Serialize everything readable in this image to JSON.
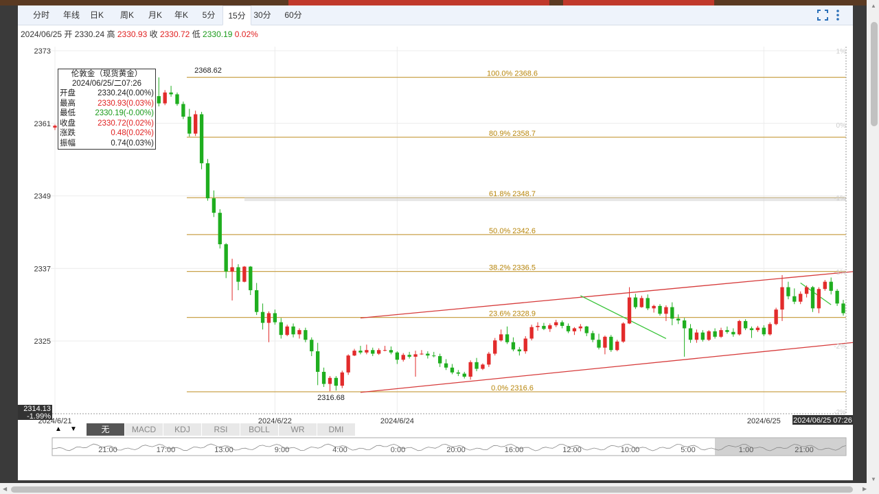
{
  "tabs": [
    {
      "label": "分时"
    },
    {
      "label": "年线"
    },
    {
      "label": "日K"
    },
    {
      "label": "周K"
    },
    {
      "label": "月K"
    },
    {
      "label": "年K"
    },
    {
      "label": "5分"
    },
    {
      "label": "15分",
      "active": true
    },
    {
      "label": "30分"
    },
    {
      "label": "60分"
    }
  ],
  "toolbar": {
    "fullscreen_icon": "fullscreen-icon",
    "menu_icon": "more-vertical-icon"
  },
  "ohlc": {
    "date": "2024/06/25",
    "open_label": "开",
    "open": "2330.24",
    "high_label": "高",
    "high": "2330.93",
    "close_label": "收",
    "close": "2330.72",
    "low_label": "低",
    "low": "2330.19",
    "change": "0.02%"
  },
  "tooltip": {
    "title": "伦敦金（现货黄金）",
    "datetime": "2024/06/25/二07:26",
    "rows": [
      {
        "label": "开盘",
        "value": "2330.24(0.00%)",
        "color": "normal"
      },
      {
        "label": "最高",
        "value": "2330.93(0.03%)",
        "color": "up"
      },
      {
        "label": "最低",
        "value": "2330.19(-0.00%)",
        "color": "dn"
      },
      {
        "label": "收盘",
        "value": "2330.72(0.02%)",
        "color": "up"
      },
      {
        "label": "涨跌",
        "value": "0.48(0.02%)",
        "color": "up"
      },
      {
        "label": "振幅",
        "value": "0.74(0.03%)",
        "color": "normal"
      }
    ]
  },
  "indicators": [
    {
      "label": "无",
      "active": true
    },
    {
      "label": "MACD"
    },
    {
      "label": "KDJ"
    },
    {
      "label": "RSI"
    },
    {
      "label": "BOLL"
    },
    {
      "label": "WR"
    },
    {
      "label": "DMI"
    }
  ],
  "nav_arrows": {
    "up": "▲",
    "down": "▼"
  },
  "chart_data": {
    "type": "candlestick",
    "y_ticks": [
      2373,
      2361,
      2349,
      2337,
      2325
    ],
    "ylim": [
      2313,
      2374
    ],
    "x_labels": [
      {
        "label": "2024/6/21",
        "at": 0
      },
      {
        "label": "2024/6/22",
        "at": 36
      },
      {
        "label": "2024/6/24",
        "at": 56
      },
      {
        "label": "2024/6/25",
        "at": 116
      }
    ],
    "crosshair_x_label": "2024/06/25 07:26",
    "crosshair_y_label": "2314.13",
    "crosshair_y_pct": "-1.99%",
    "right_pct_labels": [
      "1%",
      "0%",
      "-1%",
      "-1%",
      "-2%",
      "-2%"
    ],
    "fib_levels": [
      {
        "label": "100.0% 2368.6",
        "value": 2368.62
      },
      {
        "label": "80.9% 2358.7",
        "value": 2358.7
      },
      {
        "label": "61.8% 2348.7",
        "value": 2348.7
      },
      {
        "label": "50.0% 2342.6",
        "value": 2342.6
      },
      {
        "label": "38.2% 2336.5",
        "value": 2336.5
      },
      {
        "label": "23.6% 2328.9",
        "value": 2328.9
      },
      {
        "label": "0.0% 2316.6",
        "value": 2316.6
      }
    ],
    "high_label": "2368.62",
    "low_label": "2316.68",
    "channel_upper": [
      [
        50,
        2328.8
      ],
      [
        135,
        2336.9
      ]
    ],
    "channel_lower": [
      [
        50,
        2316.5
      ],
      [
        135,
        2325.2
      ]
    ],
    "green_trend_1": [
      [
        86,
        2332.5
      ],
      [
        100,
        2325.4
      ]
    ],
    "green_trend_2": [
      [
        122,
        2334.6
      ],
      [
        127,
        2331
      ]
    ],
    "candles": [
      [
        2360.3,
        2360.8,
        2359.9,
        2360.6
      ],
      [
        2360.6,
        2361.4,
        2360.2,
        2361.1
      ],
      [
        2361.1,
        2362,
        2360.7,
        2361.7
      ],
      [
        2361.7,
        2362.3,
        2361.3,
        2362.1
      ],
      [
        2362.1,
        2362.5,
        2361.6,
        2361.9
      ],
      [
        2361.9,
        2362.9,
        2361.5,
        2362.6
      ],
      [
        2362.6,
        2363.4,
        2362.1,
        2363.1
      ],
      [
        2363.1,
        2363.2,
        2358.5,
        2359.3
      ],
      [
        2359.3,
        2362.9,
        2358.9,
        2362.5
      ],
      [
        2362.5,
        2367.4,
        2362.2,
        2365.6
      ],
      [
        2365.6,
        2366.2,
        2363.1,
        2363.5
      ],
      [
        2363.5,
        2363.9,
        2362.3,
        2362.7
      ],
      [
        2362.7,
        2363.2,
        2360.6,
        2360.9
      ],
      [
        2360.9,
        2362.7,
        2360.6,
        2362.3
      ],
      [
        2362.3,
        2362.5,
        2361.5,
        2361.8
      ],
      [
        2361.8,
        2364.4,
        2361.5,
        2363.8
      ],
      [
        2363.8,
        2365.8,
        2363.6,
        2365.5
      ],
      [
        2365.5,
        2368.6,
        2363.8,
        2364.3
      ],
      [
        2364.3,
        2366.5,
        2364,
        2366.1
      ],
      [
        2366.1,
        2367.2,
        2365.4,
        2365.8
      ],
      [
        2365.8,
        2366.1,
        2363.9,
        2364.2
      ],
      [
        2364.2,
        2364.6,
        2361.7,
        2362.1
      ],
      [
        2362.1,
        2363.4,
        2358.8,
        2359.3
      ],
      [
        2359.3,
        2363.1,
        2358.9,
        2362.5
      ],
      [
        2362.5,
        2362.9,
        2353.4,
        2354.4
      ],
      [
        2354.4,
        2355.1,
        2348.2,
        2348.6
      ],
      [
        2348.6,
        2349.9,
        2345.5,
        2346.2
      ],
      [
        2346.2,
        2346.8,
        2340.3,
        2341
      ],
      [
        2341,
        2341.2,
        2335.4,
        2336.5
      ],
      [
        2336.5,
        2338.6,
        2331.7,
        2337.2
      ],
      [
        2337.2,
        2337.7,
        2333.4,
        2334.8
      ],
      [
        2334.8,
        2337.4,
        2334.7,
        2337.3
      ],
      [
        2337.3,
        2337.4,
        2332.6,
        2333.4
      ],
      [
        2333.4,
        2334.6,
        2329.3,
        2329.8
      ],
      [
        2329.8,
        2331.2,
        2326.9,
        2328
      ],
      [
        2328,
        2329.9,
        2324.8,
        2329.6
      ],
      [
        2329.6,
        2330.2,
        2327.7,
        2328.1
      ],
      [
        2328.1,
        2328.8,
        2325.4,
        2326
      ],
      [
        2326,
        2327.7,
        2325.8,
        2327.4
      ],
      [
        2327.4,
        2327.9,
        2325.6,
        2326.1
      ],
      [
        2326.1,
        2327.1,
        2325.4,
        2326.8
      ],
      [
        2326.8,
        2327.2,
        2324.8,
        2325.2
      ],
      [
        2325.2,
        2325.6,
        2322.5,
        2323.3
      ],
      [
        2323.3,
        2324.7,
        2317.7,
        2319.9
      ],
      [
        2319.9,
        2320.6,
        2317.4,
        2317.9
      ],
      [
        2317.9,
        2319.2,
        2316.7,
        2318.9
      ],
      [
        2318.9,
        2319.2,
        2316.8,
        2317.6
      ],
      [
        2317.6,
        2320.1,
        2317.2,
        2319.8
      ],
      [
        2319.8,
        2322.8,
        2319.4,
        2322.6
      ],
      [
        2322.6,
        2323.7,
        2322.5,
        2323.4
      ],
      [
        2323.4,
        2324.2,
        2322.8,
        2323.1
      ],
      [
        2323.1,
        2324.4,
        2322.8,
        2323.5
      ],
      [
        2323.5,
        2323.9,
        2322.5,
        2322.9
      ],
      [
        2322.9,
        2323.8,
        2322.7,
        2323.5
      ],
      [
        2323.5,
        2324.2,
        2323.3,
        2323.5
      ],
      [
        2323.5,
        2324.1,
        2322.8,
        2323.1
      ],
      [
        2323.1,
        2323.3,
        2321.2,
        2321.9
      ],
      [
        2321.9,
        2323,
        2321.6,
        2322.7
      ],
      [
        2322.7,
        2323.2,
        2322.1,
        2322.4
      ],
      [
        2322.4,
        2323.4,
        2319.1,
        2322.8
      ],
      [
        2322.8,
        2323.5,
        2322.7,
        2322.9
      ],
      [
        2322.9,
        2323.3,
        2322.1,
        2322.6
      ],
      [
        2322.6,
        2323.2,
        2322.3,
        2322.5
      ],
      [
        2322.5,
        2322.9,
        2320.7,
        2321.3
      ],
      [
        2321.3,
        2322,
        2320.2,
        2320.6
      ],
      [
        2320.6,
        2321.2,
        2319.5,
        2319.8
      ],
      [
        2319.8,
        2320.2,
        2319.2,
        2319.6
      ],
      [
        2319.6,
        2319.9,
        2318.8,
        2319.1
      ],
      [
        2319.1,
        2321.8,
        2318.6,
        2321.5
      ],
      [
        2321.5,
        2322.2,
        2320,
        2320.4
      ],
      [
        2320.4,
        2321.3,
        2320.2,
        2321.1
      ],
      [
        2321.1,
        2323.2,
        2320.7,
        2322.9
      ],
      [
        2322.9,
        2325.5,
        2322.6,
        2325.1
      ],
      [
        2325.1,
        2326.9,
        2324.9,
        2326.1
      ],
      [
        2326.1,
        2327.4,
        2324.5,
        2324.8
      ],
      [
        2324.8,
        2325.6,
        2323.3,
        2323.6
      ],
      [
        2323.6,
        2324,
        2322.6,
        2323.3
      ],
      [
        2323.3,
        2325.8,
        2322.9,
        2325.4
      ],
      [
        2325.4,
        2327.7,
        2325.1,
        2327.3
      ],
      [
        2327.3,
        2328.1,
        2326.7,
        2327.5
      ],
      [
        2327.5,
        2328,
        2326.8,
        2327
      ],
      [
        2327,
        2327.9,
        2326.5,
        2327.6
      ],
      [
        2327.6,
        2328.5,
        2327.3,
        2328.1
      ],
      [
        2328.1,
        2328.4,
        2327.1,
        2327.5
      ],
      [
        2327.5,
        2327.9,
        2326.3,
        2326.6
      ],
      [
        2326.6,
        2327.3,
        2326,
        2327.1
      ],
      [
        2327.1,
        2327.8,
        2326.6,
        2327.4
      ],
      [
        2327.4,
        2327.5,
        2325.8,
        2326.3
      ],
      [
        2326.3,
        2326.7,
        2324.8,
        2325.2
      ],
      [
        2325.2,
        2326.2,
        2323.6,
        2323.9
      ],
      [
        2323.9,
        2325.9,
        2322.8,
        2325.7
      ],
      [
        2325.7,
        2326,
        2323.2,
        2323.5
      ],
      [
        2323.5,
        2325.2,
        2323.3,
        2324.9
      ],
      [
        2324.9,
        2328.1,
        2324.7,
        2327.9
      ],
      [
        2327.9,
        2333.9,
        2327.8,
        2332.2
      ],
      [
        2332.2,
        2332.8,
        2330.3,
        2330.6
      ],
      [
        2330.6,
        2332.5,
        2330.5,
        2332.1
      ],
      [
        2332.1,
        2332.7,
        2330.1,
        2330.4
      ],
      [
        2330.4,
        2331,
        2329.7,
        2330.8
      ],
      [
        2330.8,
        2331.1,
        2329.2,
        2329.5
      ],
      [
        2329.5,
        2330.9,
        2328.3,
        2330.6
      ],
      [
        2330.6,
        2331.4,
        2327.6,
        2328.7
      ],
      [
        2328.7,
        2329.4,
        2327.8,
        2328.4
      ],
      [
        2328.4,
        2328.8,
        2322.4,
        2327.1
      ],
      [
        2327.1,
        2327.8,
        2324.7,
        2325.2
      ],
      [
        2325.2,
        2326.9,
        2324.7,
        2326.4
      ],
      [
        2326.4,
        2326.8,
        2324.9,
        2325.2
      ],
      [
        2325.2,
        2326.8,
        2325,
        2326.6
      ],
      [
        2326.6,
        2327.1,
        2325.4,
        2325.7
      ],
      [
        2325.7,
        2327.2,
        2325.5,
        2326.8
      ],
      [
        2326.8,
        2327.4,
        2326.2,
        2326.5
      ],
      [
        2326.5,
        2327.1,
        2325.7,
        2326.1
      ],
      [
        2326.1,
        2328.5,
        2325.9,
        2328.3
      ],
      [
        2328.3,
        2328.6,
        2326.8,
        2327.1
      ],
      [
        2327.1,
        2327.4,
        2325.5,
        2326.8
      ],
      [
        2326.8,
        2327.5,
        2326.5,
        2327.2
      ],
      [
        2327.2,
        2327.6,
        2325.8,
        2326.1
      ],
      [
        2326.1,
        2328.1,
        2325.9,
        2327.8
      ],
      [
        2327.8,
        2330.5,
        2327.6,
        2330.2
      ],
      [
        2330.2,
        2335.9,
        2328.3,
        2333.9
      ],
      [
        2333.9,
        2334.8,
        2331.9,
        2332.4
      ],
      [
        2332.4,
        2333.7,
        2331.1,
        2331.5
      ],
      [
        2331.5,
        2333.2,
        2331.1,
        2332.8
      ],
      [
        2332.8,
        2334.2,
        2332.2,
        2333.9
      ],
      [
        2333.9,
        2334.1,
        2329.8,
        2330.4
      ],
      [
        2330.4,
        2333.9,
        2329.6,
        2333.6
      ],
      [
        2333.6,
        2335.1,
        2333.3,
        2334.8
      ],
      [
        2334.8,
        2335.5,
        2332.7,
        2333.3
      ],
      [
        2333.3,
        2333.6,
        2330.8,
        2331.2
      ],
      [
        2331.2,
        2331.8,
        2329.2,
        2329.6
      ]
    ]
  }
}
